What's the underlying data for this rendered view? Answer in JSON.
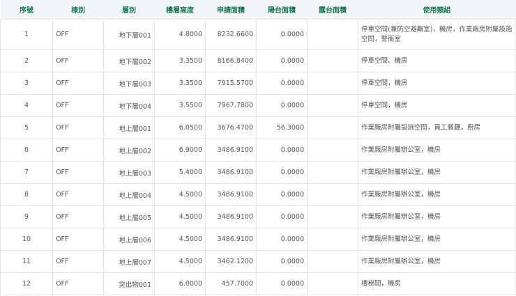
{
  "headers": [
    "序號",
    "棟別",
    "層別",
    "樓層高度",
    "申請面積",
    "陽台面積",
    "露台面積",
    "使用類組"
  ],
  "rows": [
    [
      "1",
      "OFF",
      "地下層001",
      "4.8000",
      "8232.6600",
      "0.0000",
      "",
      "停車空間(兼防空避難室)，機房，作業廠房附屬設施空間，警衛室"
    ],
    [
      "2",
      "OFF",
      "地下層002",
      "3.3500",
      "8166.8400",
      "0.0000",
      "",
      "停車空間、機房"
    ],
    [
      "3",
      "OFF",
      "地下層003",
      "3.3500",
      "7915.5700",
      "0.0000",
      "",
      "停車空間，機房"
    ],
    [
      "4",
      "OFF",
      "地下層004",
      "3.5500",
      "7967.7800",
      "0.0000",
      "",
      "停車空間，機房"
    ],
    [
      "5",
      "OFF",
      "地上層001",
      "6.0500",
      "3676.4700",
      "56.3000",
      "",
      "作業廠房附屬設施空間，員工餐廳，廚房"
    ],
    [
      "6",
      "OFF",
      "地上層002",
      "6.9000",
      "3486.9100",
      "0.0000",
      "",
      "作業廠房附屬辦公室，機房"
    ],
    [
      "7",
      "OFF",
      "地上層003",
      "5.4000",
      "3486.9100",
      "0.0000",
      "",
      "作業廠房附屬辦公室，機房"
    ],
    [
      "8",
      "OFF",
      "地上層004",
      "4.5000",
      "3486.9100",
      "0.0000",
      "",
      "作業廠房附屬辦公室，機房"
    ],
    [
      "9",
      "OFF",
      "地上層005",
      "4.5000",
      "3486.9100",
      "0.0000",
      "",
      "作業廠房附屬辦公室，機房"
    ],
    [
      "10",
      "OFF",
      "地上層006",
      "4.5000",
      "3486.9100",
      "0.0000",
      "",
      "作業廠房附屬辦公室，機房"
    ],
    [
      "11",
      "OFF",
      "地上層007",
      "4.5000",
      "3462.1200",
      "0.0000",
      "",
      "作業廠房附屬辦公室，機房"
    ],
    [
      "12",
      "OFF",
      "突出物001",
      "6.0000",
      "457.7000",
      "0.0000",
      "",
      "樓梯間，機房"
    ]
  ]
}
